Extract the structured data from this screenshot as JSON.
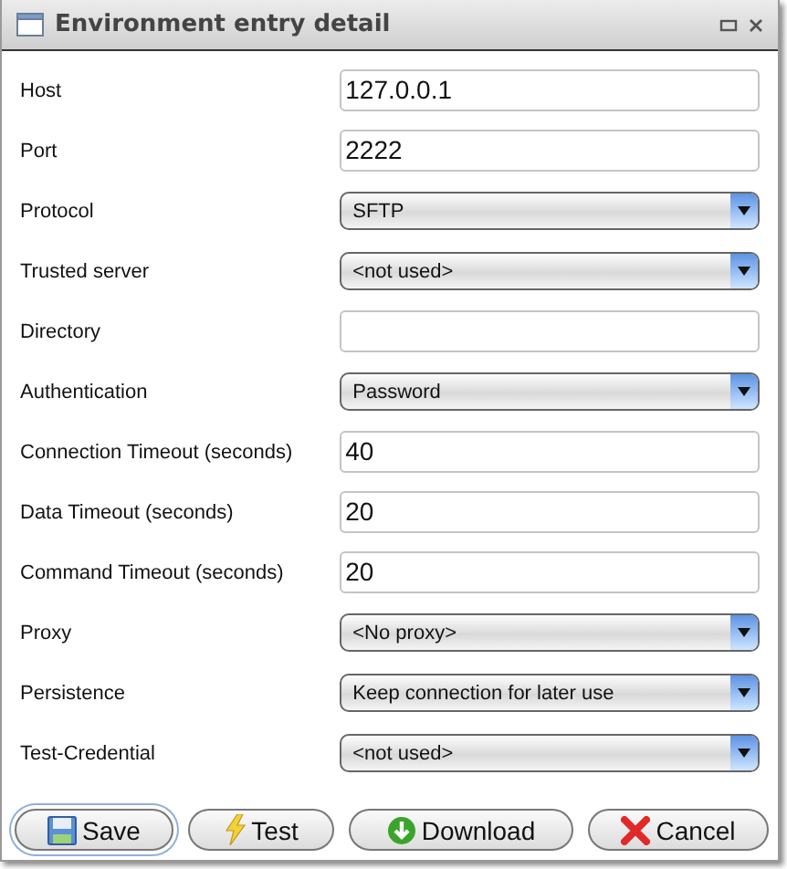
{
  "window": {
    "title": "Environment entry detail"
  },
  "fields": [
    {
      "label": "Host",
      "kind": "text",
      "value": "127.0.0.1"
    },
    {
      "label": "Port",
      "kind": "text",
      "value": "2222"
    },
    {
      "label": "Protocol",
      "kind": "select",
      "value": "SFTP"
    },
    {
      "label": "Trusted server",
      "kind": "select",
      "value": "<not used>"
    },
    {
      "label": "Directory",
      "kind": "text"
    },
    {
      "label": "Authentication",
      "kind": "select",
      "value": "Password"
    },
    {
      "label": "Connection Timeout (seconds)",
      "kind": "text",
      "value": "40"
    },
    {
      "label": "Data Timeout (seconds)",
      "kind": "text",
      "value": "20"
    },
    {
      "label": "Command Timeout (seconds)",
      "kind": "text",
      "value": "20"
    },
    {
      "label": "Proxy",
      "kind": "select",
      "value": "<No proxy>"
    },
    {
      "label": "Persistence",
      "kind": "select",
      "value": "Keep connection for later use"
    },
    {
      "label": "Test-Credential",
      "kind": "select",
      "value": "<not used>"
    }
  ],
  "buttons": [
    {
      "label": "Save",
      "kind": "save",
      "focused": true
    },
    {
      "label": "Test",
      "kind": "test",
      "focused": false
    },
    {
      "label": "Download",
      "kind": "download",
      "focused": false
    },
    {
      "label": "Cancel",
      "kind": "cancel",
      "focused": false
    }
  ]
}
